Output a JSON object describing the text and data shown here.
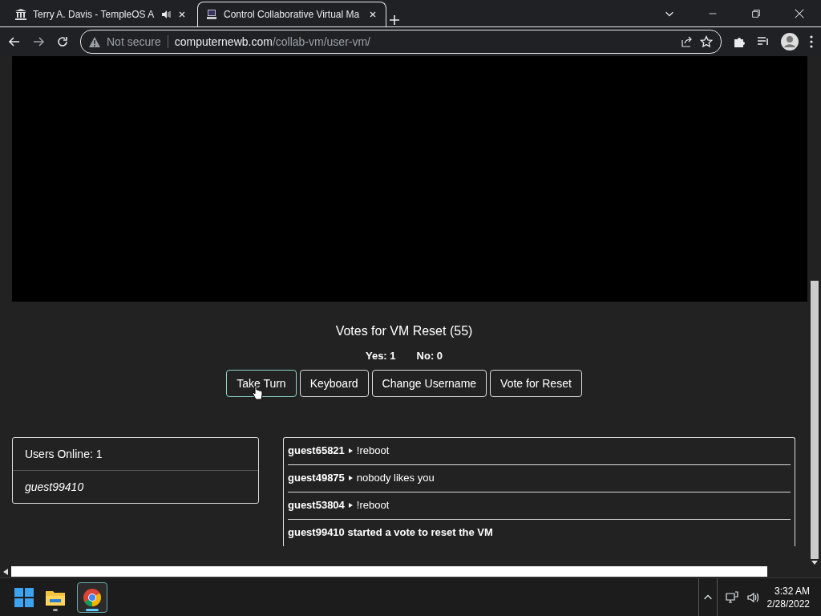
{
  "browser": {
    "tabs": [
      {
        "title": "Terry A. Davis - TempleOS A",
        "audio": true,
        "selected": false
      },
      {
        "title": "Control Collaborative Virtual Ma",
        "audio": false,
        "selected": true
      }
    ],
    "address": {
      "security": "Not secure",
      "domain": "computernewb.com",
      "path": "/collab-vm/user-vm/"
    }
  },
  "vm": {
    "votes_title": "Votes for VM Reset (55)",
    "yes": "Yes: 1",
    "no": "No: 0",
    "buttons": [
      {
        "label": "Take Turn",
        "hovered": true
      },
      {
        "label": "Keyboard",
        "hovered": false
      },
      {
        "label": "Change Username",
        "hovered": false
      },
      {
        "label": "Vote for Reset",
        "hovered": false
      }
    ]
  },
  "users": {
    "title": "Users Online: 1",
    "list": [
      "guest99410"
    ]
  },
  "chat": [
    {
      "kind": "message",
      "user": "guest65821",
      "text": "!reboot"
    },
    {
      "kind": "message",
      "user": "guest49875",
      "text": "nobody likes you"
    },
    {
      "kind": "message",
      "user": "guest53804",
      "text": "!reboot"
    },
    {
      "kind": "system",
      "text": "guest99410 started a vote to reset the VM"
    }
  ],
  "taskbar": {
    "apps": [
      {
        "kind": "explorer",
        "selected": false
      },
      {
        "kind": "chrome",
        "selected": true
      }
    ],
    "time": "3:32 AM",
    "date": "2/28/2022"
  }
}
